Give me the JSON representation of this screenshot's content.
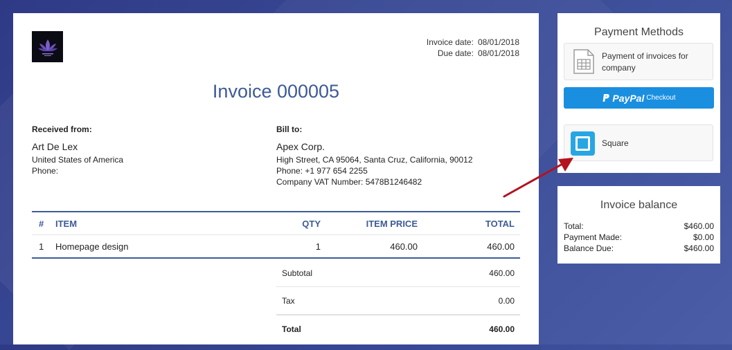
{
  "invoice": {
    "logo_icon": "lotus-logo-icon",
    "invoice_date_label": "Invoice date:",
    "invoice_date": "08/01/2018",
    "due_date_label": "Due date:",
    "due_date": "08/01/2018",
    "title": "Invoice 000005",
    "received_from": {
      "heading": "Received from:",
      "name": "Art De Lex",
      "country": "United States of America",
      "phone": "Phone:"
    },
    "bill_to": {
      "heading": "Bill to:",
      "name": "Apex Corp.",
      "address": "High Street, CA 95064, Santa Cruz, California, 90012",
      "phone": "Phone: +1 977 654 2255",
      "vat": "Company VAT Number: 5478B1246482"
    },
    "columns": [
      "#",
      "ITEM",
      "QTY",
      "ITEM PRICE",
      "TOTAL"
    ],
    "rows": [
      {
        "num": "1",
        "item": "Homepage design",
        "qty": "1",
        "price": "460.00",
        "total": "460.00"
      }
    ],
    "subtotal_label": "Subtotal",
    "subtotal": "460.00",
    "tax_label": "Tax",
    "tax": "0.00",
    "total_label": "Total",
    "total": "460.00"
  },
  "payment_methods": {
    "title": "Payment Methods",
    "option1_icon": "invoice-document-icon",
    "option1_label": "Payment of invoices for company",
    "paypal_brand": "PayPal",
    "paypal_suffix": "Checkout",
    "paypal_icon": "paypal-p-icon",
    "square_icon": "square-logo-icon",
    "square_label": "Square"
  },
  "balance": {
    "title": "Invoice balance",
    "total_label": "Total:",
    "total": "$460.00",
    "made_label": "Payment Made:",
    "made": "$0.00",
    "due_label": "Balance Due:",
    "due": "$460.00"
  },
  "colors": {
    "accent": "#3d5a98",
    "paypal": "#1a8fe0",
    "square": "#28a6e3",
    "arrow": "#b3121f"
  }
}
